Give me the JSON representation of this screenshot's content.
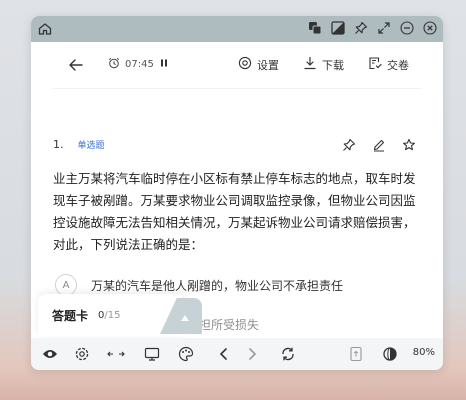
{
  "timer": {
    "value": "07:45"
  },
  "nav": {
    "settings_label": "设置",
    "download_label": "下载",
    "submit_label": "交卷"
  },
  "question": {
    "number": "1.",
    "type_tag": "单选题",
    "stem": "业主万某将汽车临时停在小区标有禁止停车标志的地点，取车时发现车子被剐蹭。万某要求物业公司调取监控录像，但物业公司因监控设施故障无法告知相关情况，万某起诉物业公司请求赔偿损害，对此，下列说法正确的是：",
    "options": [
      {
        "letter": "A",
        "text": "万某的汽车是他人剐蹭的，物业公司不承担责任"
      },
      {
        "text": "停车规定，应自行承担所受损失"
      }
    ]
  },
  "answer_card": {
    "title": "答题卡",
    "answered": "0",
    "total": "/15"
  },
  "bottom": {
    "zoom": "80%"
  },
  "colors": {
    "titlebar": "#aebcc0",
    "accent": "#3b6fd6"
  }
}
